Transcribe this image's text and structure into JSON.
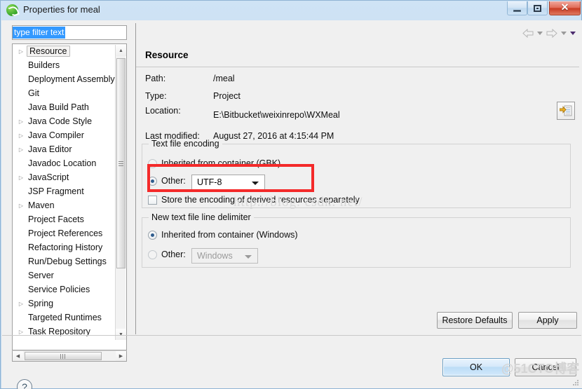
{
  "window": {
    "title": "Properties for meal",
    "icon": "spring-leaf-icon",
    "buttons": {
      "minimize": "minimize-icon",
      "maximize": "maximize-icon",
      "close": "✕"
    }
  },
  "sidebar": {
    "filter": {
      "value": "type filter text",
      "placeholder": "type filter text",
      "selected": true
    },
    "items": [
      {
        "label": "Resource",
        "expandable": true,
        "selected": true
      },
      {
        "label": "Builders",
        "expandable": false,
        "selected": false
      },
      {
        "label": "Deployment Assembly",
        "expandable": false,
        "selected": false
      },
      {
        "label": "Git",
        "expandable": false,
        "selected": false
      },
      {
        "label": "Java Build Path",
        "expandable": false,
        "selected": false
      },
      {
        "label": "Java Code Style",
        "expandable": true,
        "selected": false
      },
      {
        "label": "Java Compiler",
        "expandable": true,
        "selected": false
      },
      {
        "label": "Java Editor",
        "expandable": true,
        "selected": false
      },
      {
        "label": "Javadoc Location",
        "expandable": false,
        "selected": false
      },
      {
        "label": "JavaScript",
        "expandable": true,
        "selected": false
      },
      {
        "label": "JSP Fragment",
        "expandable": false,
        "selected": false
      },
      {
        "label": "Maven",
        "expandable": true,
        "selected": false
      },
      {
        "label": "Project Facets",
        "expandable": false,
        "selected": false
      },
      {
        "label": "Project References",
        "expandable": false,
        "selected": false
      },
      {
        "label": "Refactoring History",
        "expandable": false,
        "selected": false
      },
      {
        "label": "Run/Debug Settings",
        "expandable": false,
        "selected": false
      },
      {
        "label": "Server",
        "expandable": false,
        "selected": false
      },
      {
        "label": "Service Policies",
        "expandable": false,
        "selected": false
      },
      {
        "label": "Spring",
        "expandable": true,
        "selected": false
      },
      {
        "label": "Targeted Runtimes",
        "expandable": false,
        "selected": false
      },
      {
        "label": "Task Repository",
        "expandable": true,
        "selected": false
      }
    ]
  },
  "panel": {
    "title": "Resource",
    "nav": {
      "back": "back-arrow-icon",
      "back_menu": "chevron-down-icon",
      "forward": "forward-arrow-icon",
      "forward_menu": "chevron-down-icon",
      "view_menu": "chevron-down-icon"
    },
    "fields": [
      {
        "label": "Path:",
        "value": "/meal"
      },
      {
        "label": "Type:",
        "value": "Project"
      },
      {
        "label": "Location:",
        "value": "E:\\Bitbucket\\weixinrepo\\WXMeal"
      },
      {
        "label": "Last modified:",
        "value": "August 27, 2016 at 4:15:44 PM"
      }
    ],
    "location_button": "open-resource-icon",
    "encoding_group": {
      "title": "Text file encoding",
      "inherited_label": "Inherited from container (GBK)",
      "inherited_selected": false,
      "other_label": "Other:",
      "other_selected": true,
      "other_value": "UTF-8",
      "store_derived_label": "Store the encoding of derived resources separately",
      "store_derived_checked": false
    },
    "delimiter_group": {
      "title": "New text file line delimiter",
      "inherited_label": "Inherited from container (Windows)",
      "inherited_selected": true,
      "other_label": "Other:",
      "other_selected": false,
      "other_value": "Windows"
    }
  },
  "footer": {
    "restore_defaults": "Restore Defaults",
    "apply": "Apply",
    "ok": "OK",
    "cancel": "Cancel",
    "help": "?"
  },
  "annotations": {
    "highlight_color": "#f42a2a",
    "watermark_url": "http://blog. csdn. net/",
    "watermark_brand": "@51CTO博客"
  }
}
